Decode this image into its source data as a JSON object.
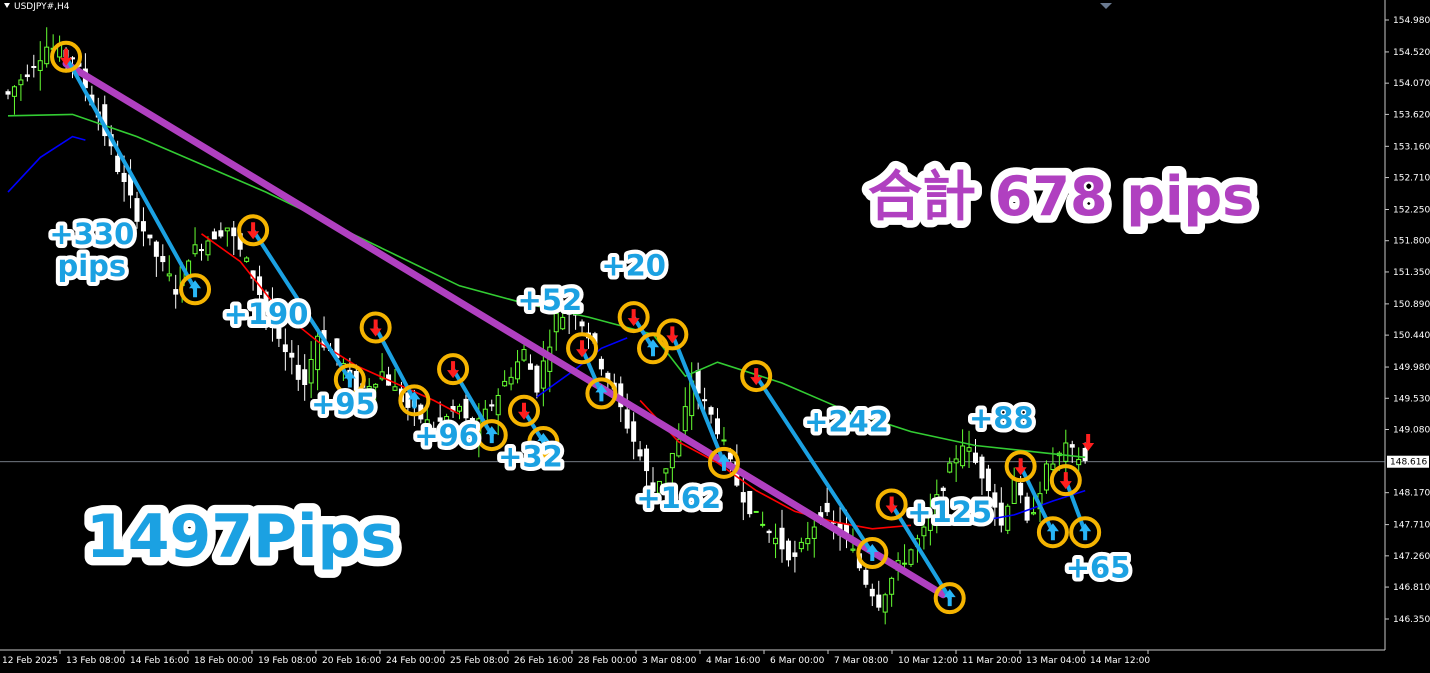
{
  "window": {
    "symbol_title": "USDJPY#,H4"
  },
  "colors": {
    "background": "#000000",
    "bull_candle": "#66ff33",
    "bear_candle": "#ffffff",
    "ma_fast": "#0000ff",
    "ma_mid": "#ff0000",
    "ma_slow": "#33cc33",
    "trade_line": "#1ba1e2",
    "trend_line": "#b040c0",
    "marker_ring": "#f5b400",
    "arrow_down": "#ff1e1e",
    "arrow_up": "#29b6f6",
    "label_blue": "#1ba1e2",
    "label_purple": "#b040c0"
  },
  "chart_data": {
    "type": "candlestick",
    "price_axis": {
      "ticks": [
        "154.980",
        "154.520",
        "154.070",
        "153.620",
        "153.160",
        "152.710",
        "152.250",
        "151.800",
        "151.350",
        "150.890",
        "150.440",
        "149.980",
        "149.530",
        "149.080",
        "148.616",
        "148.170",
        "147.710",
        "147.260",
        "146.810",
        "146.350"
      ],
      "current_price": "148.616",
      "range": [
        146.35,
        155.1
      ]
    },
    "time_axis": {
      "ticks": [
        "12 Feb 2025",
        "13 Feb 08:00",
        "14 Feb 16:00",
        "18 Feb 00:00",
        "19 Feb 08:00",
        "20 Feb 16:00",
        "24 Feb 00:00",
        "25 Feb 08:00",
        "26 Feb 16:00",
        "28 Feb 00:00",
        "3 Mar 08:00",
        "4 Mar 16:00",
        "6 Mar 00:00",
        "7 Mar 08:00",
        "10 Mar 12:00",
        "11 Mar 20:00",
        "13 Mar 04:00",
        "14 Mar 12:00"
      ]
    },
    "close_path": [
      [
        0,
        153.9
      ],
      [
        6,
        154.6
      ],
      [
        10,
        154.45
      ],
      [
        14,
        153.6
      ],
      [
        18,
        152.6
      ],
      [
        22,
        151.75
      ],
      [
        26,
        151.1
      ],
      [
        28,
        151.6
      ],
      [
        32,
        151.9
      ],
      [
        34,
        152.0
      ],
      [
        38,
        151.3
      ],
      [
        42,
        150.3
      ],
      [
        46,
        149.75
      ],
      [
        48,
        150.45
      ],
      [
        52,
        150.0
      ],
      [
        54,
        149.6
      ],
      [
        58,
        149.9
      ],
      [
        62,
        149.4
      ],
      [
        66,
        149.1
      ],
      [
        70,
        149.4
      ],
      [
        72,
        149.0
      ],
      [
        76,
        149.6
      ],
      [
        80,
        150.2
      ],
      [
        82,
        149.7
      ],
      [
        85,
        150.7
      ],
      [
        88,
        150.8
      ],
      [
        90,
        150.45
      ],
      [
        94,
        149.6
      ],
      [
        98,
        148.7
      ],
      [
        100,
        148.2
      ],
      [
        104,
        148.9
      ],
      [
        106,
        149.8
      ],
      [
        110,
        149.1
      ],
      [
        113,
        148.3
      ],
      [
        116,
        147.8
      ],
      [
        119,
        147.5
      ],
      [
        122,
        147.2
      ],
      [
        126,
        147.9
      ],
      [
        130,
        147.5
      ],
      [
        133,
        146.9
      ],
      [
        135,
        146.6
      ],
      [
        138,
        147.1
      ],
      [
        142,
        147.6
      ],
      [
        145,
        148.3
      ],
      [
        148,
        148.9
      ],
      [
        152,
        148.3
      ],
      [
        154,
        147.7
      ],
      [
        156,
        148.4
      ],
      [
        158,
        147.7
      ],
      [
        161,
        148.5
      ],
      [
        164,
        148.8
      ],
      [
        167,
        148.62
      ]
    ],
    "moving_averages": [
      {
        "color": "ma_slow",
        "points": [
          [
            0,
            153.6
          ],
          [
            10,
            153.62
          ],
          [
            20,
            153.3
          ],
          [
            30,
            152.9
          ],
          [
            40,
            152.5
          ],
          [
            50,
            152.05
          ],
          [
            60,
            151.6
          ],
          [
            70,
            151.15
          ],
          [
            80,
            150.9
          ],
          [
            90,
            150.7
          ],
          [
            100,
            150.45
          ],
          [
            105,
            149.85
          ],
          [
            110,
            150.05
          ],
          [
            120,
            149.75
          ],
          [
            130,
            149.35
          ],
          [
            140,
            149.05
          ],
          [
            150,
            148.85
          ],
          [
            160,
            148.75
          ],
          [
            167,
            148.68
          ]
        ]
      },
      {
        "color": "ma_mid",
        "points": [
          [
            30,
            151.9
          ],
          [
            36,
            151.5
          ],
          [
            42,
            150.8
          ],
          [
            48,
            150.35
          ],
          [
            54,
            150.0
          ],
          [
            60,
            149.75
          ],
          [
            66,
            149.5
          ],
          [
            70,
            149.3
          ]
        ]
      },
      {
        "color": "ma_mid",
        "points": [
          [
            98,
            149.5
          ],
          [
            104,
            148.9
          ],
          [
            110,
            148.6
          ],
          [
            116,
            148.2
          ],
          [
            122,
            147.9
          ],
          [
            128,
            147.75
          ],
          [
            134,
            147.65
          ],
          [
            140,
            147.7
          ]
        ]
      },
      {
        "color": "ma_fast",
        "points": [
          [
            0,
            152.5
          ],
          [
            5,
            153.0
          ],
          [
            10,
            153.3
          ],
          [
            12,
            153.25
          ]
        ]
      },
      {
        "color": "ma_fast",
        "points": [
          [
            82,
            149.55
          ],
          [
            88,
            149.95
          ],
          [
            92,
            150.25
          ],
          [
            96,
            150.4
          ]
        ]
      },
      {
        "color": "ma_fast",
        "points": [
          [
            150,
            147.75
          ],
          [
            156,
            147.85
          ],
          [
            162,
            148.05
          ],
          [
            167,
            148.2
          ]
        ]
      }
    ],
    "trades": [
      {
        "entry": [
          9,
          154.45
        ],
        "exit": [
          29,
          151.1
        ],
        "label": "+330\npips",
        "label_at": [
          13,
          151.75
        ]
      },
      {
        "entry": [
          38,
          151.95
        ],
        "exit": [
          53,
          149.8
        ],
        "label": "+190",
        "label_at": [
          40,
          150.6
        ]
      },
      {
        "entry": [
          57,
          150.55
        ],
        "exit": [
          63,
          149.5
        ],
        "label": "+95",
        "label_at": [
          52,
          149.3
        ]
      },
      {
        "entry": [
          69,
          149.95
        ],
        "exit": [
          75,
          149.0
        ],
        "label": "+96",
        "label_at": [
          68,
          148.85
        ]
      },
      {
        "entry": [
          80,
          149.35
        ],
        "exit": [
          83,
          148.9
        ],
        "label": "+32",
        "label_at": [
          81,
          148.55
        ]
      },
      {
        "entry": [
          89,
          150.25
        ],
        "exit": [
          92,
          149.6
        ],
        "label": "+52",
        "label_at": [
          84,
          150.8
        ]
      },
      {
        "entry": [
          97,
          150.7
        ],
        "exit": [
          100,
          150.25
        ],
        "label": "+20",
        "label_at": [
          97,
          151.3
        ]
      },
      {
        "entry": [
          103,
          150.45
        ],
        "exit": [
          111,
          148.6
        ],
        "label": "+162",
        "label_at": [
          104,
          147.95
        ]
      },
      {
        "entry": [
          116,
          149.85
        ],
        "exit": [
          134,
          147.3
        ],
        "label": "+242",
        "label_at": [
          130,
          149.05
        ]
      },
      {
        "entry": [
          137,
          148.0
        ],
        "exit": [
          146,
          146.65
        ],
        "label": "+125",
        "label_at": [
          146,
          147.75
        ]
      },
      {
        "entry": [
          157,
          148.55
        ],
        "exit": [
          162,
          147.6
        ],
        "label": "+88",
        "label_at": [
          154,
          149.1
        ]
      },
      {
        "entry": [
          164,
          148.35
        ],
        "exit": [
          167,
          147.6
        ],
        "label": "+65",
        "label_at": [
          169,
          146.95
        ]
      }
    ],
    "overall_trade": {
      "entry": [
        9,
        154.35
      ],
      "exit": [
        145,
        146.7
      ],
      "label": "合計 678 pips"
    },
    "total_label": "1497Pips",
    "latest_signal": "sell"
  }
}
